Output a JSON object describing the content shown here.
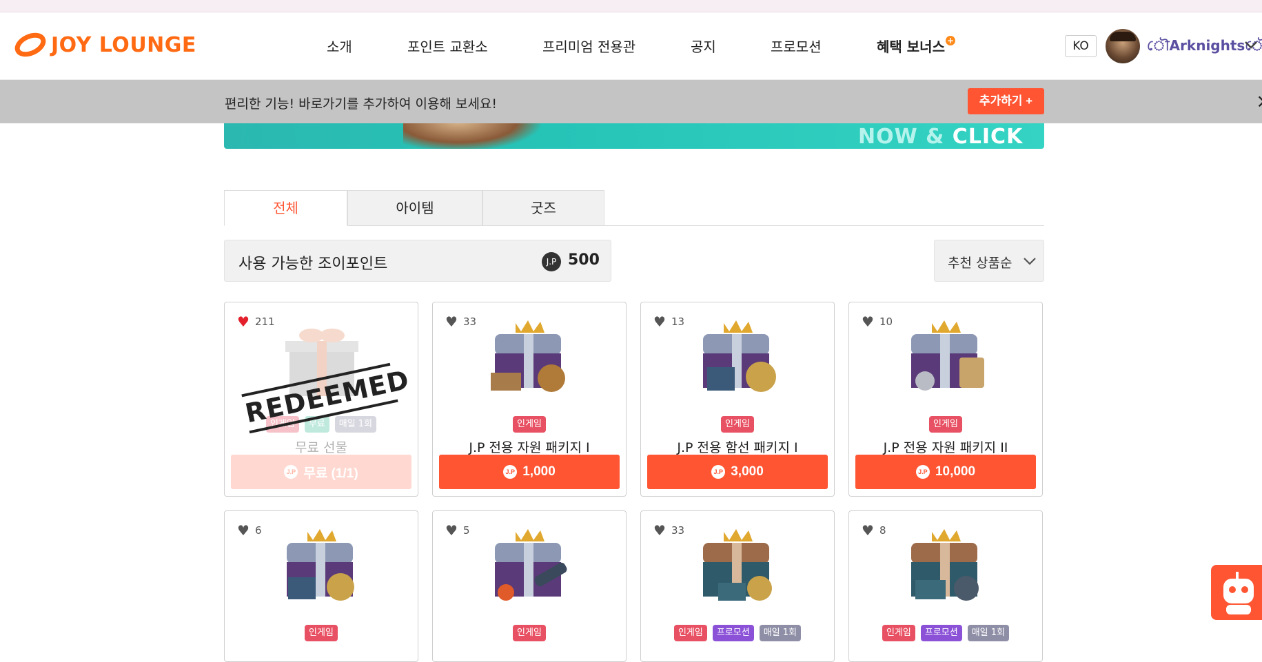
{
  "header": {
    "logo_text": "JOY LOUNGE",
    "nav": [
      {
        "label": "소개"
      },
      {
        "label": "포인트 교환소"
      },
      {
        "label": "프리미엄 전용관"
      },
      {
        "label": "공지"
      },
      {
        "label": "프로모션"
      },
      {
        "label": "혜택 보너스"
      }
    ],
    "bonus_badge": "+",
    "lang": "KO",
    "username": "ৌArknightsৌ"
  },
  "shortcut_bar": {
    "text": "편리한 기능! 바로가기를 추가하여 이용해 보세요!",
    "button": "추가하기 +",
    "close": "×"
  },
  "hero": {
    "text_light": "NOW & ",
    "text_bold": "CLICK"
  },
  "tabs": [
    {
      "label": "전체"
    },
    {
      "label": "아이템"
    },
    {
      "label": "굿즈"
    }
  ],
  "points": {
    "label": "사용 가능한 조이포인트",
    "coin": "J.P",
    "value": "500"
  },
  "sort": {
    "label": "추천 상품순"
  },
  "coin_small": "J.P",
  "stamp": "REDEEMED",
  "products": [
    {
      "likes": "211",
      "tags": [
        "인게임",
        "무료",
        "매일 1회"
      ],
      "name": "무료 선물",
      "price": "무료 (1/1)"
    },
    {
      "likes": "33",
      "tags": [
        "인게임"
      ],
      "name": "J.P 전용 자원 패키지 I",
      "price": "1,000"
    },
    {
      "likes": "13",
      "tags": [
        "인게임"
      ],
      "name": "J.P 전용 함선 패키지 I",
      "price": "3,000"
    },
    {
      "likes": "10",
      "tags": [
        "인게임"
      ],
      "name": "J.P 전용 자원 패키지 II",
      "price": "10,000"
    },
    {
      "likes": "6",
      "tags": [
        "인게임"
      ]
    },
    {
      "likes": "5",
      "tags": [
        "인게임"
      ]
    },
    {
      "likes": "33",
      "tags": [
        "인게임",
        "프로모션",
        "매일 1회"
      ]
    },
    {
      "likes": "8",
      "tags": [
        "인게임",
        "프로모션",
        "매일 1회"
      ]
    }
  ],
  "colors": {
    "accent": "#ff5533",
    "brand": "#ff6a13",
    "tag_ingame": "#e85163",
    "tag_promo": "#8b52d8",
    "tag_daily": "#8e8ea6"
  }
}
